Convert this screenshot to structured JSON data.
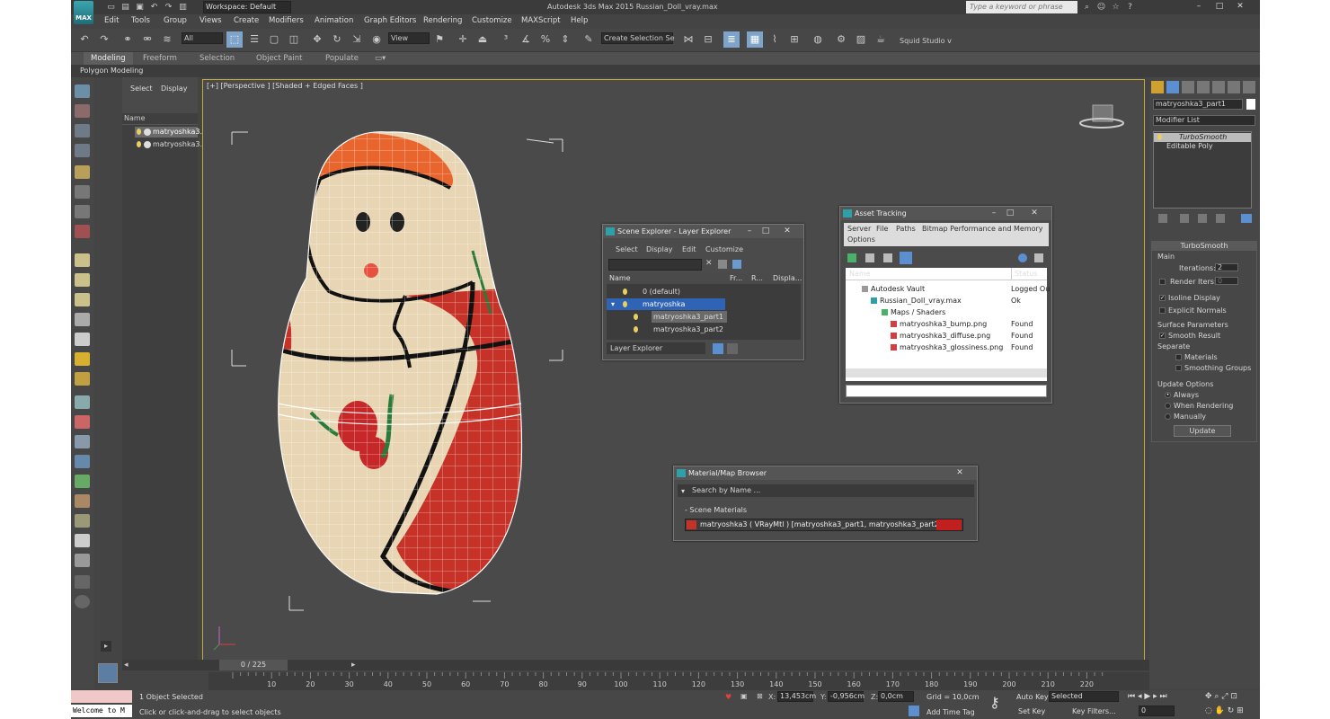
{
  "app": {
    "logo_text": "MAX",
    "workspace": "Workspace: Default",
    "title": "Autodesk 3ds Max 2015    Russian_Doll_vray.max",
    "search_placeholder": "Type a keyword or phrase"
  },
  "menu": [
    "Edit",
    "Tools",
    "Group",
    "Views",
    "Create",
    "Modifiers",
    "Animation",
    "Graph Editors",
    "Rendering",
    "Customize",
    "MAXScript",
    "Help"
  ],
  "toolbar": {
    "filter": "All",
    "view": "View",
    "selection_set": "Create Selection Se",
    "squid": "Squid Studio v"
  },
  "ribbon": {
    "tabs": [
      "Modeling",
      "Freeform",
      "Selection",
      "Object Paint",
      "Populate"
    ],
    "subtab": "Polygon Modeling"
  },
  "scene_panel": {
    "tabs": [
      "Select",
      "Display"
    ],
    "header": "Name",
    "items": [
      "matryoshka3.",
      "matryoshka3."
    ]
  },
  "viewport": {
    "label": "[+] [Perspective ] [Shaded + Edged Faces ]"
  },
  "scene_explorer": {
    "title": "Scene Explorer - Layer Explorer",
    "menu": [
      "Select",
      "Display",
      "Edit",
      "Customize"
    ],
    "cols": [
      "Name",
      "Fr...",
      "R...",
      "Displa..."
    ],
    "rows": [
      "0 (default)",
      "matryoshka",
      "matryoshka3_part1",
      "matryoshka3_part2"
    ],
    "footer": "Layer Explorer"
  },
  "asset_tracking": {
    "title": "Asset Tracking",
    "menu1": [
      "Server",
      "File",
      "Paths",
      "Bitmap Performance and Memory"
    ],
    "menu2": "Options",
    "cols": [
      "Name",
      "Status"
    ],
    "rows": [
      {
        "name": "Autodesk Vault",
        "status": "Logged Ou"
      },
      {
        "name": "Russian_Doll_vray.max",
        "status": "Ok"
      },
      {
        "name": "Maps / Shaders",
        "status": ""
      },
      {
        "name": "matryoshka3_bump.png",
        "status": "Found"
      },
      {
        "name": "matryoshka3_diffuse.png",
        "status": "Found"
      },
      {
        "name": "matryoshka3_glossiness.png",
        "status": "Found"
      }
    ]
  },
  "material_browser": {
    "title": "Material/Map Browser",
    "search": "Search by Name ...",
    "section": "- Scene Materials",
    "item": "matryoshka3  ( VRayMtl )  [matryoshka3_part1, matryoshka3_part2]"
  },
  "command_panel": {
    "object_name": "matryoshka3_part1",
    "modifier_list": "Modifier List",
    "stack": [
      "TurboSmooth",
      "Editable Poly"
    ],
    "rollout": "TurboSmooth",
    "main": "Main",
    "iterations_label": "Iterations:",
    "iterations": "2",
    "render_iters_label": "Render Iters:",
    "render_iters": "0",
    "isoline": "Isoline Display",
    "explicit": "Explicit Normals",
    "surface": "Surface Parameters",
    "smooth": "Smooth Result",
    "separate": "Separate",
    "materials": "Materials",
    "smoothing": "Smoothing Groups",
    "update_options": "Update Options",
    "always": "Always",
    "when_rendering": "When Rendering",
    "manually": "Manually",
    "update_btn": "Update"
  },
  "timeline": {
    "frame": "0 / 225",
    "ticks": [
      "10",
      "20",
      "30",
      "40",
      "50",
      "60",
      "70",
      "80",
      "90",
      "100",
      "110",
      "120",
      "130",
      "140",
      "150",
      "160",
      "170",
      "180",
      "190",
      "200",
      "210",
      "220"
    ]
  },
  "status": {
    "welcome": "Welcome to M",
    "selected": "1 Object Selected",
    "hint": "Click or click-and-drag to select objects",
    "x_label": "X:",
    "x": "13,453cm",
    "y_label": "Y:",
    "y": "-0,956cm",
    "z_label": "Z:",
    "z": "0,0cm",
    "grid": "Grid = 10,0cm",
    "autokey": "Auto Key",
    "selected_mode": "Selected",
    "setkey": "Set Key",
    "keyfilters": "Key Filters...",
    "addtime": "Add Time Tag",
    "frame_field": "0"
  }
}
